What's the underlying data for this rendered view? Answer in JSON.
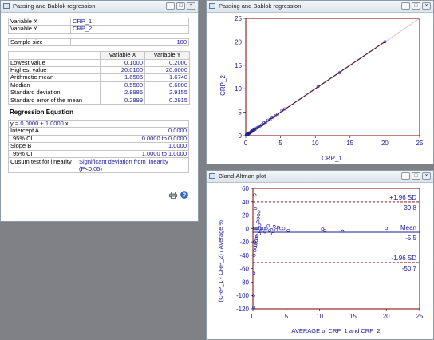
{
  "left_window": {
    "title": "Passing and Bablok regression",
    "variable_x_label": "Variable X",
    "variable_x_value": "CRP_1",
    "variable_y_label": "Variable Y",
    "variable_y_value": "CRP_2",
    "sample_size_label": "Sample size",
    "sample_size_value": "100",
    "stats_header": [
      "",
      "Variable X",
      "Variable Y"
    ],
    "stats_rows": [
      [
        "Lowest value",
        "0.1000",
        "0.2000"
      ],
      [
        "Highest value",
        "20.0100",
        "20.0000"
      ],
      [
        "Arithmetic mean",
        "1.6506",
        "1.6740"
      ],
      [
        "Median",
        "0.5500",
        "0.6000"
      ],
      [
        "Standard deviation",
        "2.8985",
        "2.9155"
      ],
      [
        "Standard error of the mean",
        "0.2899",
        "0.2915"
      ]
    ],
    "regression_title": "Regression Equation",
    "equation": {
      "y": "y",
      "eq": "=",
      "intercept": "0.0000",
      "plus": "+",
      "slope": "1.0000",
      "x": "x"
    },
    "intercept_label": "Intercept A",
    "intercept_value": "0.0000",
    "intercept_ci_label": "95% CI",
    "intercept_ci_value": "0.0000 to 0.0000",
    "slope_label": "Slope B",
    "slope_value": "1.0000",
    "slope_ci_label": "95% CI",
    "slope_ci_value": "1.0000 to 1.0000",
    "cusum_label": "Cusum test for linearity",
    "cusum_value": "Significant deviation from linearity (P<0.05)"
  },
  "scatter_window": {
    "title": "Passing and Bablok regression",
    "chart_data": {
      "type": "scatter",
      "title": "",
      "xlabel": "CRP_1",
      "ylabel": "CRP_2",
      "xlim": [
        0,
        25
      ],
      "ylim": [
        0,
        25
      ],
      "x_ticks": [
        "0",
        "5",
        "10",
        "15",
        "20",
        "25"
      ],
      "y_ticks": [
        "0",
        "5",
        "10",
        "15",
        "20",
        "25"
      ],
      "points": [
        [
          0.1,
          0.2
        ],
        [
          0.2,
          0.2
        ],
        [
          0.2,
          0.3
        ],
        [
          0.3,
          0.3
        ],
        [
          0.3,
          0.4
        ],
        [
          0.4,
          0.4
        ],
        [
          0.5,
          0.5
        ],
        [
          0.5,
          0.6
        ],
        [
          0.6,
          0.6
        ],
        [
          0.7,
          0.7
        ],
        [
          0.8,
          0.9
        ],
        [
          0.9,
          0.9
        ],
        [
          1.0,
          1.1
        ],
        [
          1.1,
          1.0
        ],
        [
          1.2,
          1.3
        ],
        [
          1.3,
          1.3
        ],
        [
          1.5,
          1.6
        ],
        [
          1.7,
          1.7
        ],
        [
          1.9,
          2.0
        ],
        [
          2.1,
          2.1
        ],
        [
          2.3,
          2.3
        ],
        [
          2.6,
          2.7
        ],
        [
          2.9,
          2.9
        ],
        [
          3.2,
          3.3
        ],
        [
          3.5,
          3.4
        ],
        [
          3.8,
          3.9
        ],
        [
          4.2,
          4.2
        ],
        [
          4.6,
          4.6
        ],
        [
          5.2,
          5.4
        ],
        [
          5.6,
          5.7
        ],
        [
          10.4,
          10.5
        ],
        [
          13.5,
          13.4
        ],
        [
          20.01,
          20.0
        ]
      ],
      "regression_line": {
        "intercept": 0.0,
        "slope": 1.0
      },
      "colors": {
        "line": "#4d1a33",
        "identity": "#d9b3c4",
        "points": "#1a1a9e",
        "frame": "#800000"
      }
    }
  },
  "ba_window": {
    "title": "Bland-Altman plot",
    "chart_data": {
      "type": "scatter",
      "title": "",
      "xlabel": "AVERAGE of CRP_1 and CRP_2",
      "ylabel": "(CRP_1 - CRP_2) / Average %",
      "xlim": [
        0,
        25
      ],
      "ylim": [
        -120,
        60
      ],
      "x_ticks": [
        "0",
        "5",
        "10",
        "15",
        "20",
        "25"
      ],
      "y_ticks": [
        "60",
        "40",
        "20",
        "0",
        "-20",
        "-40",
        "-60",
        "-80",
        "-100",
        "-120"
      ],
      "upper_loa": {
        "label": "+1.96 SD",
        "value": "39.8",
        "y": 39.8
      },
      "mean": {
        "label": "Mean",
        "value": "-5.5",
        "y": -5.5
      },
      "lower_loa": {
        "label": "-1.96 SD",
        "value": "-50.7",
        "y": -50.7
      },
      "points": [
        [
          0.1,
          -100
        ],
        [
          0.12,
          -118
        ],
        [
          0.15,
          -66.7
        ],
        [
          0.2,
          -40
        ],
        [
          0.25,
          0
        ],
        [
          0.25,
          -20
        ],
        [
          0.3,
          -33
        ],
        [
          0.35,
          -28
        ],
        [
          0.4,
          -25
        ],
        [
          0.45,
          -22
        ],
        [
          0.5,
          -18
        ],
        [
          0.55,
          -15
        ],
        [
          0.6,
          -12
        ],
        [
          0.65,
          -10
        ],
        [
          0.7,
          0
        ],
        [
          0.75,
          10
        ],
        [
          0.8,
          15
        ],
        [
          0.85,
          20
        ],
        [
          0.9,
          25
        ],
        [
          0.95,
          -8
        ],
        [
          1.0,
          5
        ],
        [
          1.05,
          0
        ],
        [
          1.2,
          -4
        ],
        [
          1.3,
          0
        ],
        [
          1.6,
          0
        ],
        [
          1.8,
          -5
        ],
        [
          2.0,
          0
        ],
        [
          2.3,
          4
        ],
        [
          2.5,
          -3
        ],
        [
          2.8,
          -2
        ],
        [
          3.0,
          -8
        ],
        [
          3.2,
          3
        ],
        [
          3.5,
          -2
        ],
        [
          3.8,
          2
        ],
        [
          4.2,
          0
        ],
        [
          4.6,
          0
        ],
        [
          5.3,
          -3
        ],
        [
          10.45,
          -1
        ],
        [
          10.8,
          -3
        ],
        [
          13.45,
          -4
        ],
        [
          20.0,
          0.05
        ],
        [
          0.3,
          50
        ],
        [
          0.4,
          30
        ],
        [
          0.5,
          0
        ]
      ],
      "colors": {
        "mean_line": "#1a1a9e",
        "loa_line": "#800000",
        "points": "#1a1a9e",
        "frame": "#800000"
      }
    }
  }
}
